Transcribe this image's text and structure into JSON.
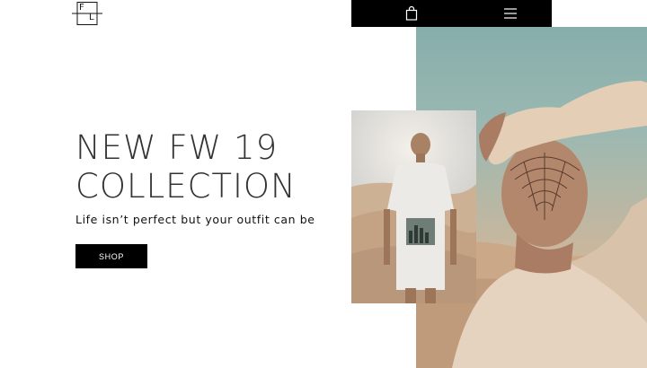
{
  "logo": {
    "letters": [
      "F",
      "L"
    ]
  },
  "topbar": {
    "cart_icon": "shopping-bag-icon",
    "menu_icon": "hamburger-menu-icon"
  },
  "hero": {
    "title_line1": "NEW FW 19",
    "title_line2": "COLLECTION",
    "tagline": "Life isn’t perfect but your outfit can be",
    "cta_label": "SHOP"
  },
  "colors": {
    "bar": "#000000",
    "button": "#000000",
    "button_text": "#ffffff",
    "title": "#333333"
  }
}
